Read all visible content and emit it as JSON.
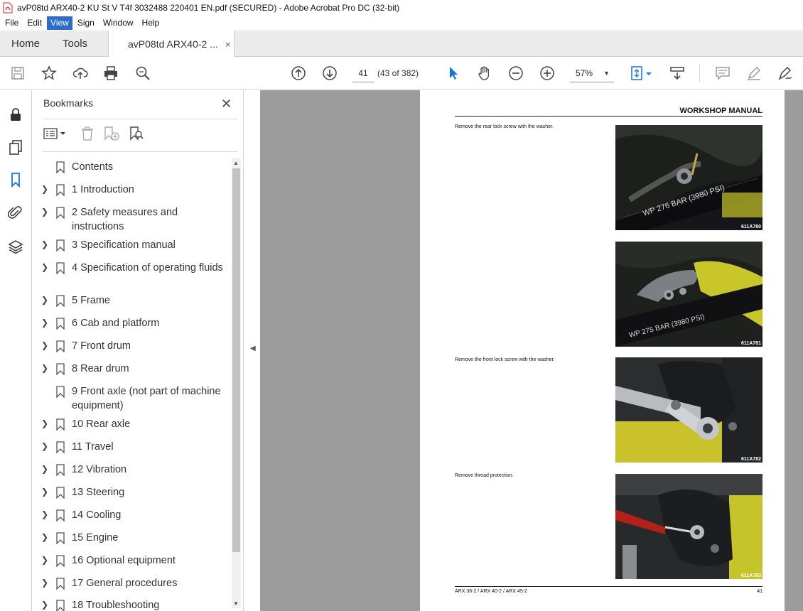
{
  "window": {
    "title": "avP08td ARX40-2 KU St V T4f 3032488 220401 EN.pdf (SECURED) - Adobe Acrobat Pro DC (32-bit)"
  },
  "menu": {
    "items": [
      "File",
      "Edit",
      "View",
      "Sign",
      "Window",
      "Help"
    ],
    "active": "View"
  },
  "tabs": {
    "home": "Home",
    "tools": "Tools",
    "document": "avP08td ARX40-2 ...",
    "close": "×"
  },
  "toolbar": {
    "page_number": "41",
    "page_count": "(43 of 382)",
    "zoom": "57%"
  },
  "bookmarks": {
    "title": "Bookmarks",
    "close": "✕",
    "items": [
      {
        "label": "Contents",
        "expandable": false
      },
      {
        "label": "1 Introduction",
        "expandable": true
      },
      {
        "label": "2 Safety measures and instructions",
        "expandable": true
      },
      {
        "label": "3 Specification manual",
        "expandable": true
      },
      {
        "label": "4 Specification of operating fluids",
        "expandable": true
      },
      {
        "label": "5 Frame",
        "expandable": true
      },
      {
        "label": "6 Cab and platform",
        "expandable": true
      },
      {
        "label": "7 Front drum",
        "expandable": true
      },
      {
        "label": "8 Rear drum",
        "expandable": true
      },
      {
        "label": "9 Front axle (not part of machine equipment)",
        "expandable": false
      },
      {
        "label": "10 Rear axle",
        "expandable": true
      },
      {
        "label": "11 Travel",
        "expandable": true
      },
      {
        "label": "12 Vibration",
        "expandable": true
      },
      {
        "label": "13 Steering",
        "expandable": true
      },
      {
        "label": "14 Cooling",
        "expandable": true
      },
      {
        "label": "15 Engine",
        "expandable": true
      },
      {
        "label": "16 Optional equipment",
        "expandable": true
      },
      {
        "label": "17 General procedures",
        "expandable": true
      },
      {
        "label": "18 Troubleshooting",
        "expandable": true
      }
    ]
  },
  "page": {
    "header": "WORKSHOP MANUAL",
    "steps": [
      "Remove the rear lock screw with the washer.",
      "Remove the front lock screw with the washer.",
      "Remove thread protection."
    ],
    "photos": [
      {
        "caption": "611A780",
        "hose_text": "WP 276 BAR (3980 PSI)"
      },
      {
        "caption": "611A781",
        "hose_text": "WP 275 BAR (3980 PSI)"
      },
      {
        "caption": "611A782",
        "hose_text": ""
      },
      {
        "caption": "611A783",
        "hose_text": ""
      }
    ],
    "footer_left": "ARX 36-2 / ARX 40-2 / ARX 45-2",
    "footer_right": "41"
  },
  "colors": {
    "menu_active": "#2d6cc9",
    "pdf_red": "#d9261c",
    "select_blue": "#1473e6",
    "doc_background": "#9c9c9c"
  }
}
